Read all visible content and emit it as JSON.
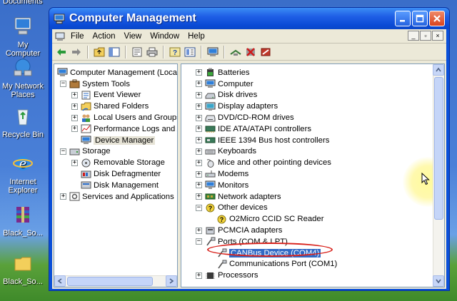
{
  "desktop": {
    "top_label": "Documents",
    "icons": [
      {
        "label": "My\nComputer"
      },
      {
        "label": "My Network\nPlaces"
      },
      {
        "label": "Recycle Bin"
      },
      {
        "label": "Internet\nExplorer"
      },
      {
        "label": "Black_So..."
      },
      {
        "label": "Black_So..."
      }
    ]
  },
  "window": {
    "title": "Computer Management",
    "menu": [
      "File",
      "Action",
      "View",
      "Window",
      "Help"
    ]
  },
  "left_tree": [
    {
      "label": "Computer Management (Local",
      "level": 0,
      "expander": "",
      "icon": "computer-management-icon"
    },
    {
      "label": "System Tools",
      "level": 1,
      "expander": "-",
      "icon": "system-tools-icon"
    },
    {
      "label": "Event Viewer",
      "level": 2,
      "expander": "+",
      "icon": "event-viewer-icon"
    },
    {
      "label": "Shared Folders",
      "level": 2,
      "expander": "+",
      "icon": "shared-folders-icon"
    },
    {
      "label": "Local Users and Groups",
      "level": 2,
      "expander": "+",
      "icon": "users-icon"
    },
    {
      "label": "Performance Logs and A",
      "level": 2,
      "expander": "+",
      "icon": "performance-icon"
    },
    {
      "label": "Device Manager",
      "level": 2,
      "expander": "",
      "icon": "device-manager-icon",
      "selected": true
    },
    {
      "label": "Storage",
      "level": 1,
      "expander": "-",
      "icon": "storage-icon"
    },
    {
      "label": "Removable Storage",
      "level": 2,
      "expander": "+",
      "icon": "removable-storage-icon"
    },
    {
      "label": "Disk Defragmenter",
      "level": 2,
      "expander": "",
      "icon": "defrag-icon"
    },
    {
      "label": "Disk Management",
      "level": 2,
      "expander": "",
      "icon": "disk-management-icon"
    },
    {
      "label": "Services and Applications",
      "level": 1,
      "expander": "+",
      "icon": "services-icon"
    }
  ],
  "device_tree": [
    {
      "label": "Batteries",
      "level": 0,
      "expander": "+",
      "icon": "battery-icon"
    },
    {
      "label": "Computer",
      "level": 0,
      "expander": "+",
      "icon": "computer-icon"
    },
    {
      "label": "Disk drives",
      "level": 0,
      "expander": "+",
      "icon": "disk-drive-icon"
    },
    {
      "label": "Display adapters",
      "level": 0,
      "expander": "+",
      "icon": "display-adapter-icon"
    },
    {
      "label": "DVD/CD-ROM drives",
      "level": 0,
      "expander": "+",
      "icon": "dvd-icon"
    },
    {
      "label": "IDE ATA/ATAPI controllers",
      "level": 0,
      "expander": "+",
      "icon": "ide-controller-icon"
    },
    {
      "label": "IEEE 1394 Bus host controllers",
      "level": 0,
      "expander": "+",
      "icon": "ieee1394-icon"
    },
    {
      "label": "Keyboards",
      "level": 0,
      "expander": "+",
      "icon": "keyboard-icon"
    },
    {
      "label": "Mice and other pointing devices",
      "level": 0,
      "expander": "+",
      "icon": "mouse-icon"
    },
    {
      "label": "Modems",
      "level": 0,
      "expander": "+",
      "icon": "modem-icon"
    },
    {
      "label": "Monitors",
      "level": 0,
      "expander": "+",
      "icon": "monitor-icon"
    },
    {
      "label": "Network adapters",
      "level": 0,
      "expander": "+",
      "icon": "network-adapter-icon"
    },
    {
      "label": "Other devices",
      "level": 0,
      "expander": "-",
      "icon": "unknown-device-icon"
    },
    {
      "label": "O2Micro CCID SC Reader",
      "level": 1,
      "expander": "",
      "icon": "unknown-device-icon"
    },
    {
      "label": "PCMCIA adapters",
      "level": 0,
      "expander": "+",
      "icon": "pcmcia-icon"
    },
    {
      "label": "Ports (COM & LPT)",
      "level": 0,
      "expander": "-",
      "icon": "port-icon"
    },
    {
      "label": "CANBus Device (COM4)",
      "level": 1,
      "expander": "",
      "icon": "port-icon",
      "highlighted": true
    },
    {
      "label": "Communications Port (COM1)",
      "level": 1,
      "expander": "",
      "icon": "port-icon"
    },
    {
      "label": "Processors",
      "level": 0,
      "expander": "+",
      "icon": "processor-icon"
    }
  ]
}
